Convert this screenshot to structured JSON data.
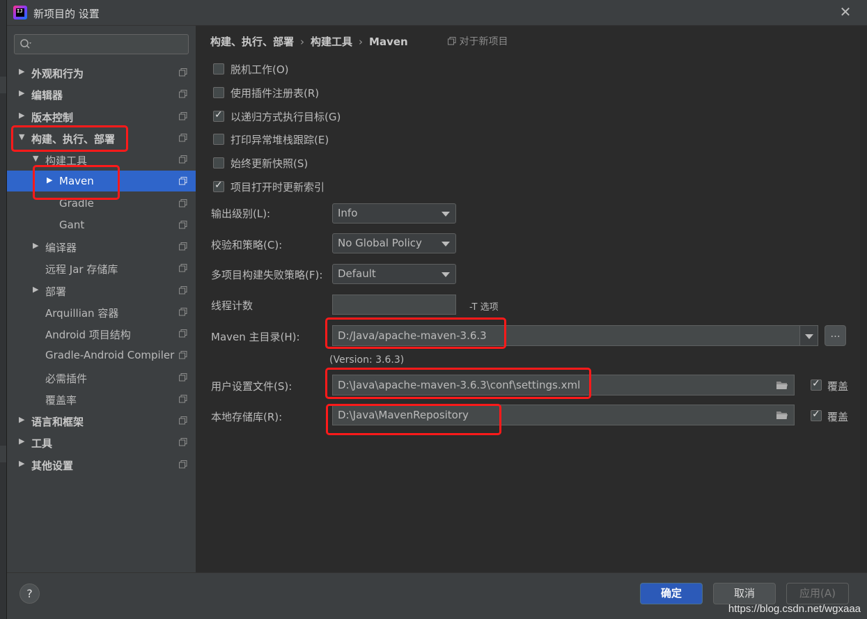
{
  "window": {
    "title": "新项目的 设置"
  },
  "search": {
    "placeholder": ""
  },
  "sidebar": {
    "items": [
      {
        "label": "外观和行为",
        "arrow": "▶"
      },
      {
        "label": "编辑器",
        "arrow": "▶"
      },
      {
        "label": "版本控制",
        "arrow": "▶"
      },
      {
        "label": "构建、执行、部署",
        "arrow": "▼"
      },
      {
        "label": "构建工具",
        "arrow": "▼"
      },
      {
        "label": "Maven",
        "arrow": "▶"
      },
      {
        "label": "Gradle",
        "arrow": ""
      },
      {
        "label": "Gant",
        "arrow": ""
      },
      {
        "label": "编译器",
        "arrow": "▶"
      },
      {
        "label": "远程 Jar 存储库",
        "arrow": ""
      },
      {
        "label": "部署",
        "arrow": "▶"
      },
      {
        "label": "Arquillian 容器",
        "arrow": ""
      },
      {
        "label": "Android 项目结构",
        "arrow": ""
      },
      {
        "label": "Gradle-Android Compiler",
        "arrow": ""
      },
      {
        "label": "必需插件",
        "arrow": ""
      },
      {
        "label": "覆盖率",
        "arrow": ""
      },
      {
        "label": "语言和框架",
        "arrow": "▶"
      },
      {
        "label": "工具",
        "arrow": "▶"
      },
      {
        "label": "其他设置",
        "arrow": "▶"
      }
    ]
  },
  "breadcrumb": {
    "part1": "构建、执行、部署",
    "sep": "›",
    "part2": "构建工具",
    "part3": "Maven"
  },
  "for_new_project": "对于新项目",
  "options": [
    {
      "label": "脱机工作(O)",
      "checked": false
    },
    {
      "label": "使用插件注册表(R)",
      "checked": false
    },
    {
      "label": "以递归方式执行目标(G)",
      "checked": true
    },
    {
      "label": "打印异常堆栈跟踪(E)",
      "checked": false
    },
    {
      "label": "始终更新快照(S)",
      "checked": false
    },
    {
      "label": "项目打开时更新索引",
      "checked": true
    }
  ],
  "form": {
    "output_level_label": "输出级别(L):",
    "output_level_value": "Info",
    "checksum_label": "校验和策略(C):",
    "checksum_value": "No Global Policy",
    "failure_label": "多项目构建失败策略(F):",
    "failure_value": "Default",
    "thread_label": "线程计数",
    "thread_value": "",
    "thread_hint": "-T 选项",
    "maven_home_label": "Maven 主目录(H):",
    "maven_home_value": "D:/Java/apache-maven-3.6.3",
    "browse_label": "...",
    "version": "(Version: 3.6.3)",
    "user_settings_label": "用户设置文件(S):",
    "user_settings_value": "D:\\Java\\apache-maven-3.6.3\\conf\\settings.xml",
    "user_settings_override": "覆盖",
    "local_repo_label": "本地存储库(R):",
    "local_repo_value": "D:\\Java\\MavenRepository",
    "local_repo_override": "覆盖"
  },
  "footer": {
    "help": "?",
    "ok": "确定",
    "cancel": "取消",
    "apply": "应用(A)"
  },
  "watermark": "https://blog.csdn.net/wgxaaa",
  "colors": {
    "accent": "#2f65ca",
    "annotation": "#ff1a1a",
    "background": "#2b2b2b",
    "panel": "#3c3f41"
  }
}
